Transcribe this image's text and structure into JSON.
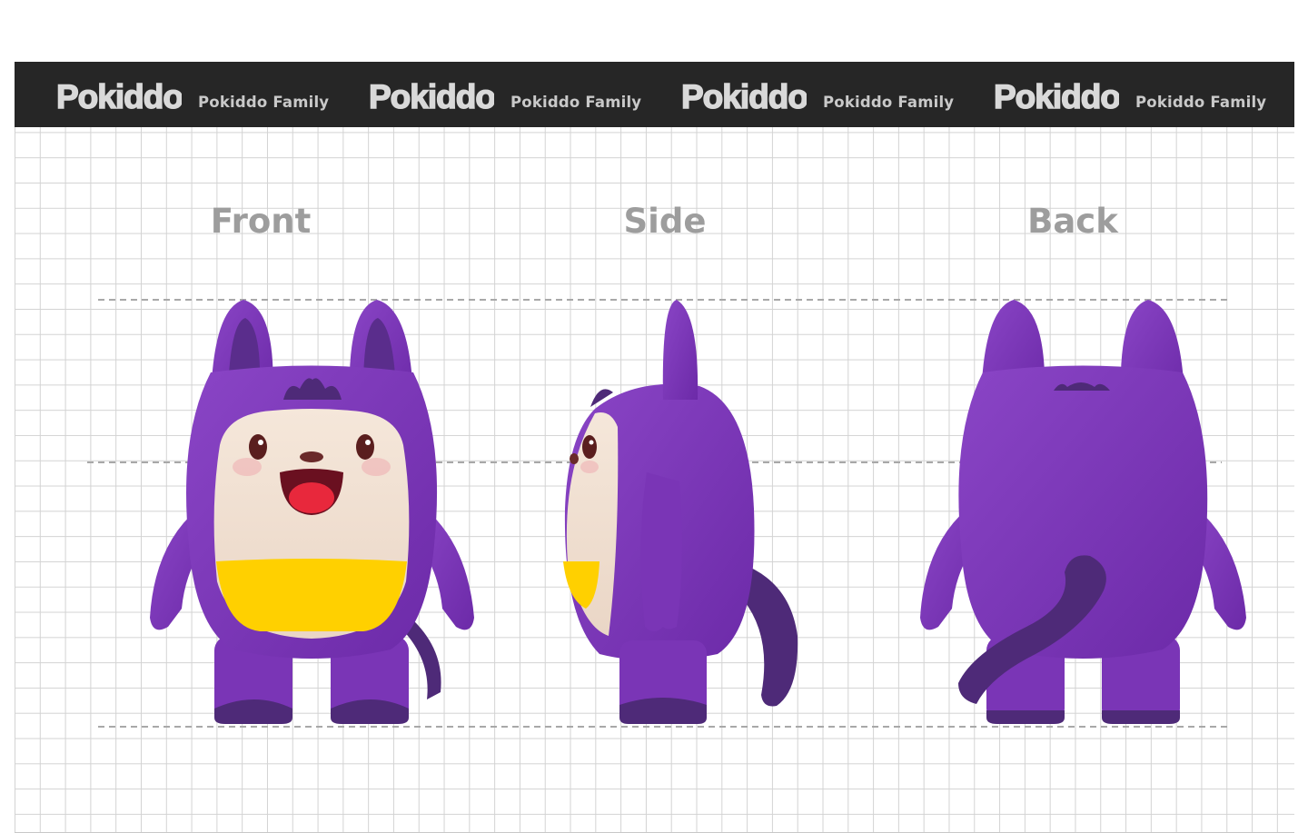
{
  "banner": {
    "items": [
      {
        "logo": "Pokiddo",
        "tagline": "Pokiddo Family"
      },
      {
        "logo": "Pokiddo",
        "tagline": "Pokiddo Family"
      },
      {
        "logo": "Pokiddo",
        "tagline": "Pokiddo Family"
      },
      {
        "logo": "Pokiddo",
        "tagline": "Pokiddo Family"
      }
    ]
  },
  "views": {
    "front": "Front",
    "side": "Side",
    "back": "Back"
  },
  "colors": {
    "banner_bg": "#262626",
    "body_purple": "#7a35b6",
    "dark_purple": "#4e2a78",
    "face_cream": "#f2e3d5",
    "bib_yellow": "#ffd000",
    "mouth_red": "#e8283c",
    "label_gray": "#9d9d9d"
  }
}
